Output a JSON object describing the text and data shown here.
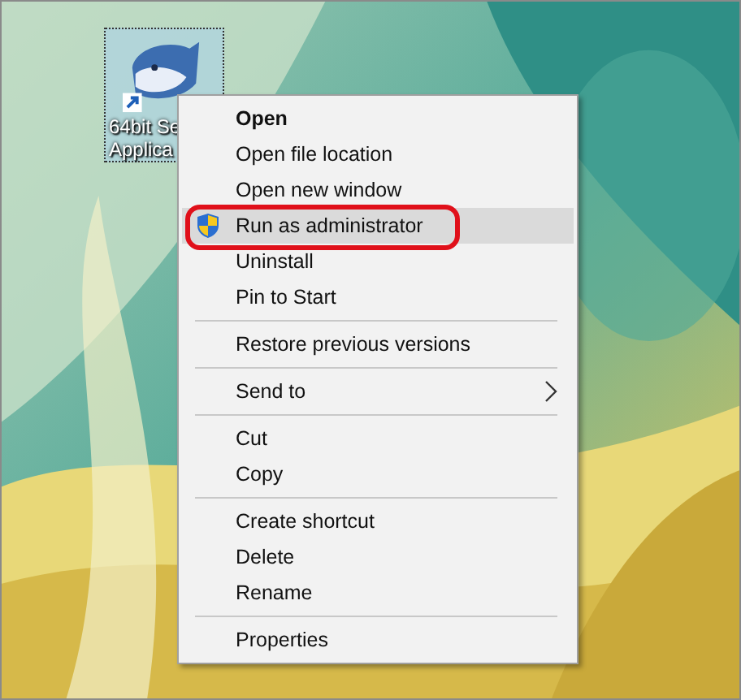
{
  "desktop": {
    "icon": {
      "label_lines": [
        "64bit Se",
        "Applica"
      ],
      "selected": true
    }
  },
  "context_menu": {
    "items": [
      {
        "kind": "item",
        "label": "Open",
        "bold": true,
        "selected": false,
        "submenu": false,
        "annotated": false
      },
      {
        "kind": "item",
        "label": "Open file location",
        "bold": false,
        "selected": false,
        "submenu": false,
        "annotated": false
      },
      {
        "kind": "item",
        "label": "Open new window",
        "bold": false,
        "selected": false,
        "submenu": false,
        "annotated": false
      },
      {
        "kind": "admin_item",
        "label": "Run as administrator",
        "bold": false,
        "selected": true,
        "submenu": false,
        "annotated": true
      },
      {
        "kind": "item",
        "label": "Uninstall",
        "bold": false,
        "selected": false,
        "submenu": false,
        "annotated": false
      },
      {
        "kind": "item",
        "label": "Pin to Start",
        "bold": false,
        "selected": false,
        "submenu": false,
        "annotated": false
      },
      {
        "kind": "separator"
      },
      {
        "kind": "item",
        "label": "Restore previous versions",
        "bold": false,
        "selected": false,
        "submenu": false,
        "annotated": false
      },
      {
        "kind": "separator"
      },
      {
        "kind": "item",
        "label": "Send to",
        "bold": false,
        "selected": false,
        "submenu": true,
        "annotated": false
      },
      {
        "kind": "separator"
      },
      {
        "kind": "item",
        "label": "Cut",
        "bold": false,
        "selected": false,
        "submenu": false,
        "annotated": false
      },
      {
        "kind": "item",
        "label": "Copy",
        "bold": false,
        "selected": false,
        "submenu": false,
        "annotated": false
      },
      {
        "kind": "separator"
      },
      {
        "kind": "item",
        "label": "Create shortcut",
        "bold": false,
        "selected": false,
        "submenu": false,
        "annotated": false
      },
      {
        "kind": "item",
        "label": "Delete",
        "bold": false,
        "selected": false,
        "submenu": false,
        "annotated": false
      },
      {
        "kind": "item",
        "label": "Rename",
        "bold": false,
        "selected": false,
        "submenu": false,
        "annotated": false
      },
      {
        "kind": "separator"
      },
      {
        "kind": "item",
        "label": "Properties",
        "bold": false,
        "selected": false,
        "submenu": false,
        "annotated": false
      }
    ]
  }
}
